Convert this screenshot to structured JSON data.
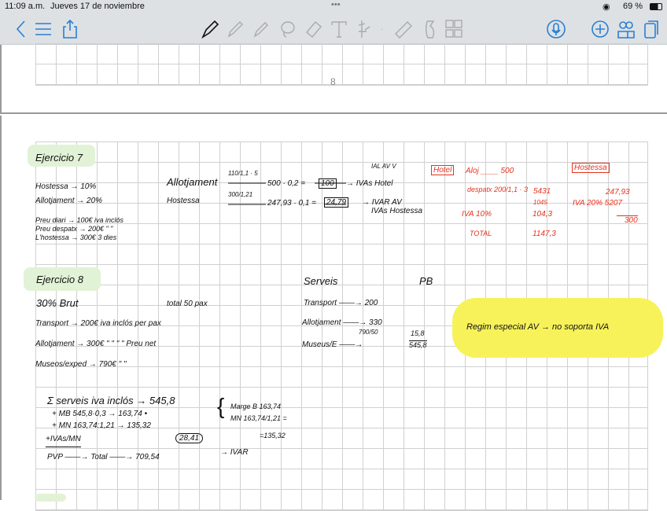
{
  "status": {
    "time": "11:09 a.m.",
    "date": "Jueves 17 de noviembre",
    "battery": "69 %"
  },
  "page_number": "8",
  "ex7": {
    "title": "Ejercicio 7",
    "left": [
      "Hostessa → 10%",
      "Allotjament → 20%",
      "Preu diari → 100€ iva inclós",
      "Preu despatx → 200€ \"  \"",
      "L'hostessa → 300€ 3 dies"
    ],
    "calc": [
      "Allotjament",
      "110/1,1 · 5",
      "500 · 0,2 =",
      "100",
      "→ IVAs Hotel",
      "Hostessa",
      "300/1,21",
      "247,93 · 0,1 =",
      "24,79",
      "→ IVAR AV",
      "IVAs Hostessa",
      "IAL AV   V"
    ],
    "red": [
      "Hotel",
      "Aloj ____ 500",
      "despatx 200/1,1 · 3",
      "5431",
      "1045",
      "IVA  10%",
      "104,3",
      "TOTAL",
      "1147,3",
      "Hostessa",
      "247,93",
      "IVA 20% 5207",
      "300"
    ]
  },
  "ex8": {
    "title": "Ejercicio 8",
    "left": [
      "30% Brut",
      "total   50 pax",
      "Transport → 200€ iva inclós per pax",
      "Allotjament → 300€  \"  \"  \"  \"  Preu net",
      "Museos/exped → 790€  \"  \""
    ],
    "serveis": [
      "Serveis",
      "PB",
      "Transport ——→ 200",
      "Allotjament ——→ 330",
      "790/50",
      "Museus/E ——→",
      "15,8",
      "545,8"
    ],
    "highlight": "Regim especial AV → no soporta IVA",
    "sum": [
      "Σ serveis iva inclós → 545,8",
      "+ MB  545,8·0,3 → 163,74 •",
      "+ MN  163,74:1,21 → 135,32",
      "+IVAs/MN",
      "28,41",
      "PVP ——→ Total ——→ 709,54",
      "→ IVAR",
      "Marge B  163,74",
      "MN  163,74/1,21 =",
      "=135,32"
    ]
  }
}
